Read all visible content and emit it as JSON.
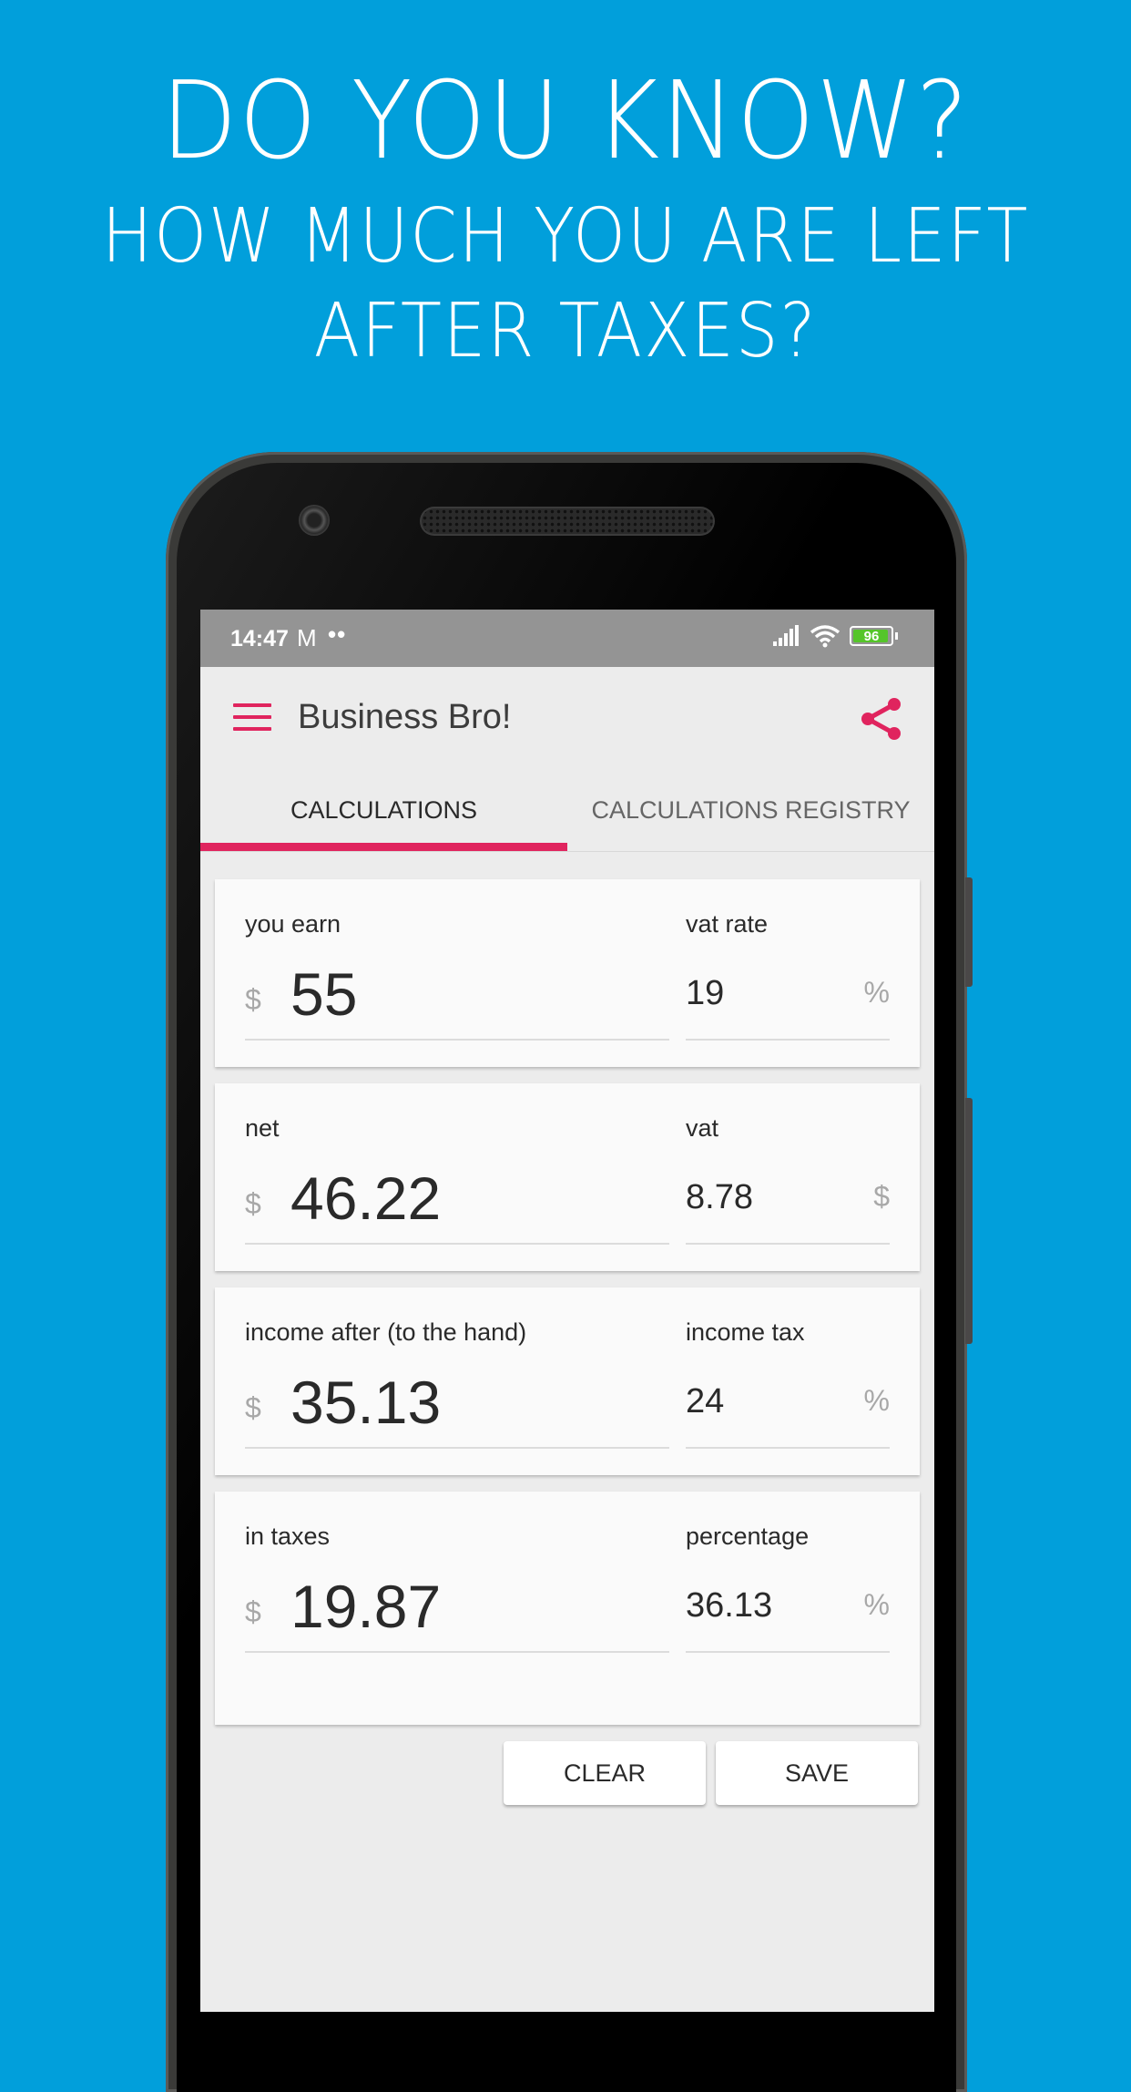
{
  "promo": {
    "line1": "DO YOU KNOW?",
    "line2": "HOW MUCH YOU ARE LEFT",
    "line3": "AFTER TAXES?"
  },
  "status_bar": {
    "time": "14:47",
    "notification_icons": [
      "gmail-icon",
      "more-notifications-dots"
    ],
    "mail_glyph": "M",
    "dots": "••",
    "battery_level": "96",
    "battery_fraction": 0.96
  },
  "app_bar": {
    "title": "Business Bro!",
    "menu_icon": "hamburger-menu-icon",
    "share_icon": "share-icon"
  },
  "tabs": [
    {
      "label": "CALCULATIONS",
      "active": true
    },
    {
      "label": "CALCULATIONS REGISTRY",
      "active": false
    }
  ],
  "cards": [
    {
      "main": {
        "label": "you earn",
        "currency": "$",
        "value": "55"
      },
      "side": {
        "label": "vat rate",
        "value": "19",
        "unit": "%"
      }
    },
    {
      "main": {
        "label": "net",
        "currency": "$",
        "value": "46.22"
      },
      "side": {
        "label": "vat",
        "value": "8.78",
        "unit": "$"
      }
    },
    {
      "main": {
        "label": "income after (to the hand)",
        "currency": "$",
        "value": "35.13"
      },
      "side": {
        "label": "income tax",
        "value": "24",
        "unit": "%"
      }
    },
    {
      "main": {
        "label": "in taxes",
        "currency": "$",
        "value": "19.87"
      },
      "side": {
        "label": "percentage",
        "value": "36.13",
        "unit": "%"
      }
    }
  ],
  "actions": {
    "clear_label": "CLEAR",
    "save_label": "SAVE"
  },
  "colors": {
    "background": "#019fdb",
    "accent": "#e0245e",
    "status_bar": "#949494",
    "screen_bg": "#ececec",
    "card_bg": "#fafafa",
    "battery": "#55c52a"
  }
}
